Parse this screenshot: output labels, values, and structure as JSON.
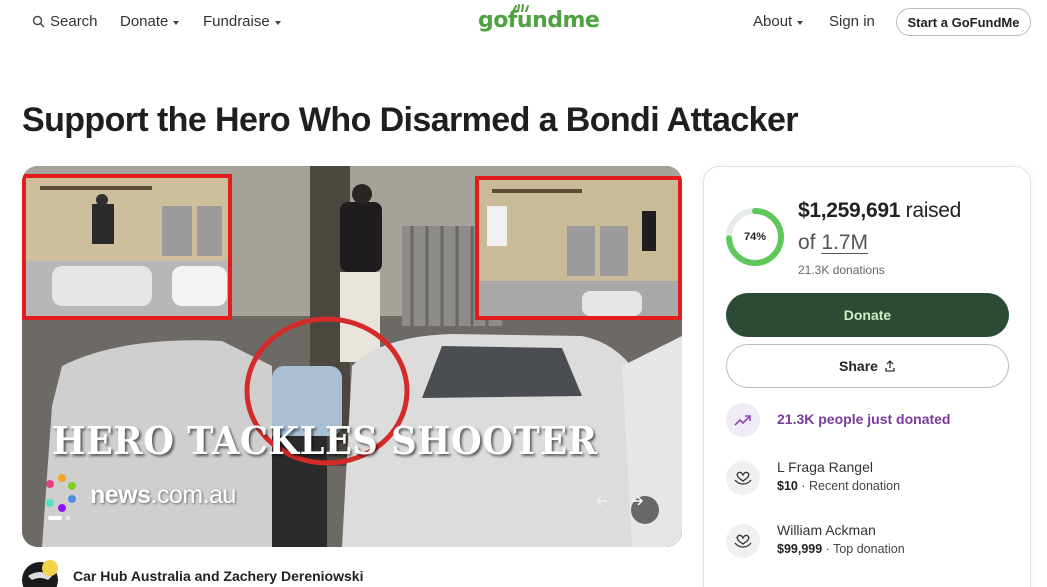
{
  "nav": {
    "search_label": "Search",
    "donate_label": "Donate",
    "fundraise_label": "Fundraise",
    "logo_text": "gofundme",
    "about_label": "About",
    "signin_label": "Sign in",
    "start_label": "Start a GoFundMe"
  },
  "campaign": {
    "title": "Support the Hero Who Disarmed a Bondi Attacker",
    "image_caption": "HERO TACKLES SHOOTER",
    "image_watermark_bold": "news",
    "image_watermark_rest": ".com.au",
    "organizer": "Car Hub Australia and Zachery Dereniowski"
  },
  "donation_card": {
    "progress_percent": 74,
    "progress_label": "74%",
    "raised_amount": "$1,259,691",
    "raised_label": "raised",
    "goal_prefix": "of",
    "goal_amount": "1.7M",
    "donation_count": "21.3K donations",
    "donate_label": "Donate",
    "share_label": "Share",
    "trending_text": "21.3K people just donated",
    "donors": [
      {
        "name": "L Fraga Rangel",
        "amount": "$10",
        "note": "· Recent donation"
      },
      {
        "name": "William Ackman",
        "amount": "$99,999",
        "note": "· Top donation"
      }
    ]
  },
  "colors": {
    "brand_green": "#4fa142",
    "donate_bg": "#2b4b35",
    "trending_purple": "#7a3b9a"
  }
}
